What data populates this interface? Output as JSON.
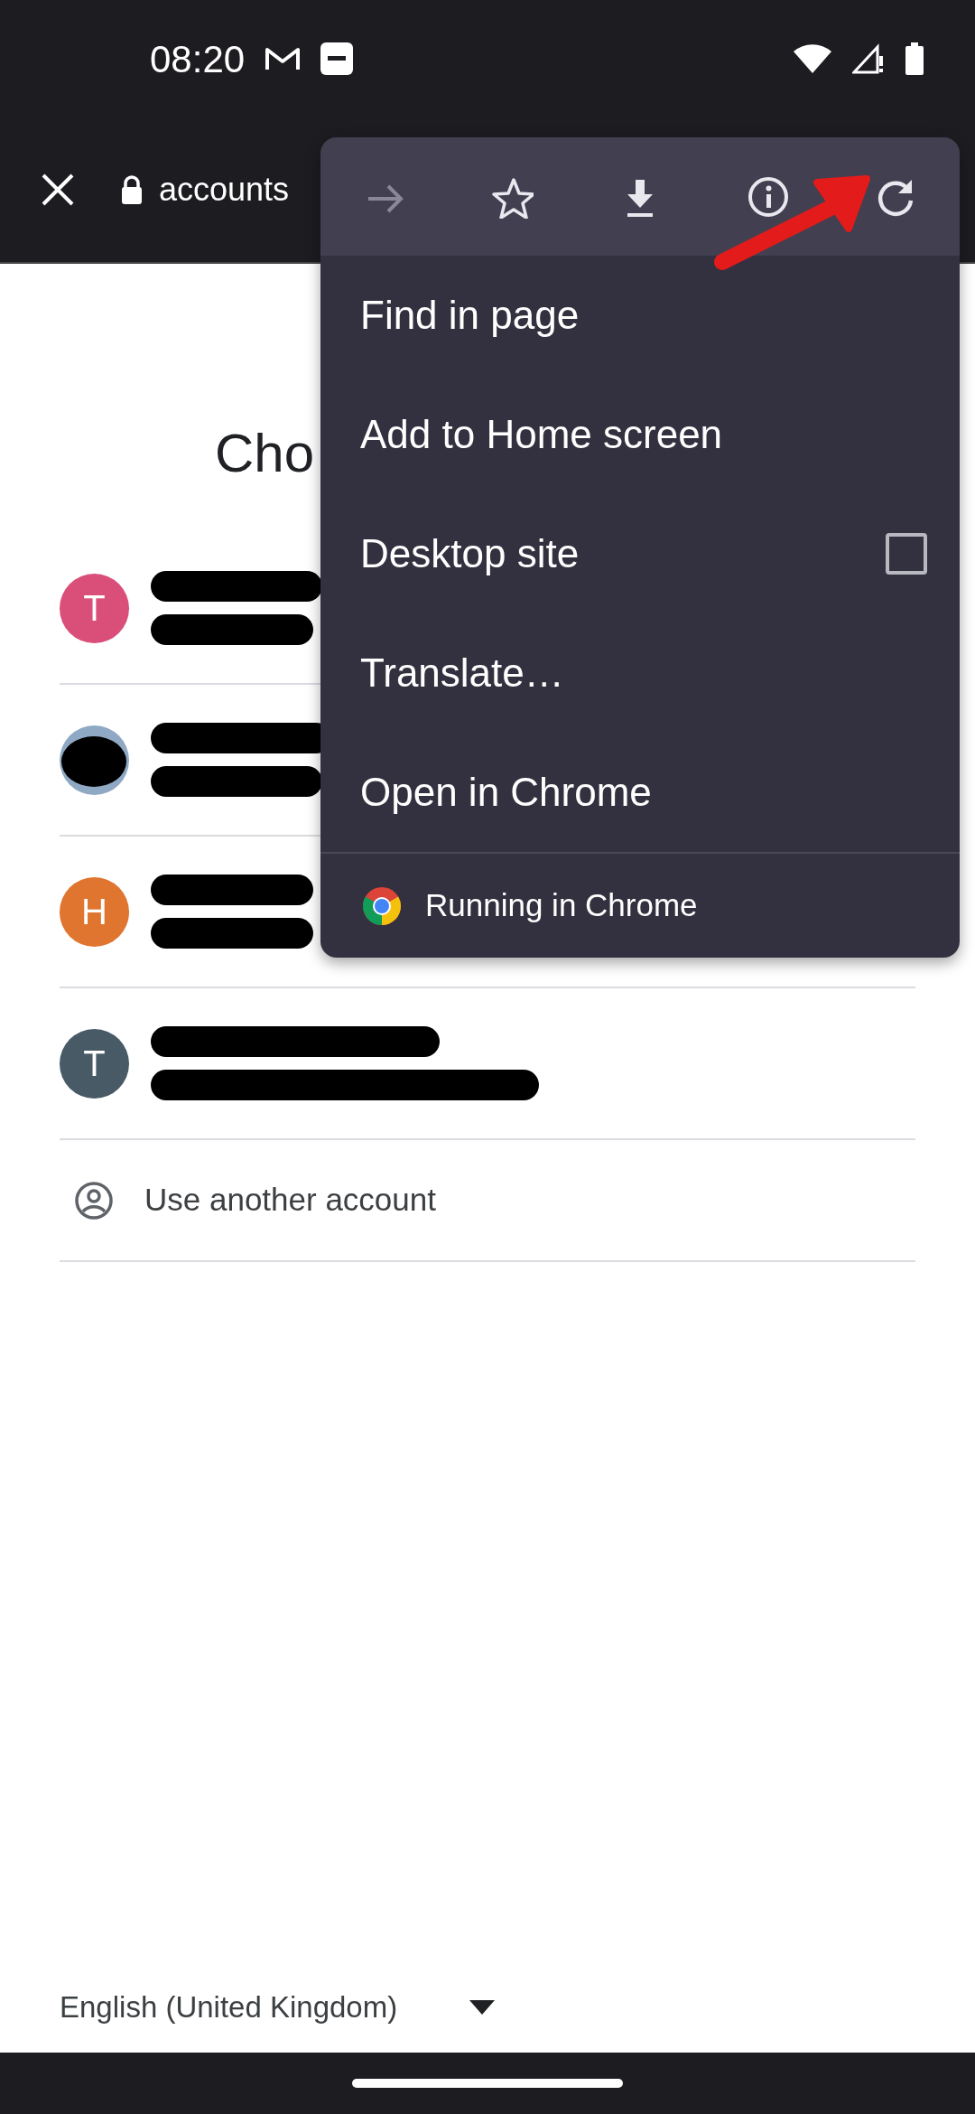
{
  "status_bar": {
    "time": "08:20"
  },
  "toolbar": {
    "url": "accounts"
  },
  "page": {
    "heading": "Cho",
    "accounts": [
      {
        "kind": "letter",
        "avatar_letter": "T",
        "color": "#d94f7a"
      },
      {
        "kind": "photo"
      },
      {
        "kind": "letter",
        "avatar_letter": "H",
        "color": "#e0752f"
      },
      {
        "kind": "letter",
        "avatar_letter": "T",
        "color": "#485a66"
      }
    ],
    "other_account": "Use another account",
    "language": "English (United Kingdom)"
  },
  "menu": {
    "icons": [
      {
        "kind": "forward",
        "disabled": true
      },
      {
        "kind": "star",
        "disabled": false
      },
      {
        "kind": "download",
        "disabled": false
      },
      {
        "kind": "info",
        "disabled": false
      },
      {
        "kind": "reload",
        "disabled": false
      }
    ],
    "items": [
      {
        "kind": "plain",
        "label": "Find in page"
      },
      {
        "kind": "plain",
        "label": "Add to Home screen"
      },
      {
        "kind": "checkbox",
        "label": "Desktop site",
        "checked": false
      },
      {
        "kind": "plain",
        "label": "Translate…"
      },
      {
        "kind": "plain",
        "label": "Open in Chrome"
      }
    ],
    "footer": "Running in Chrome"
  }
}
